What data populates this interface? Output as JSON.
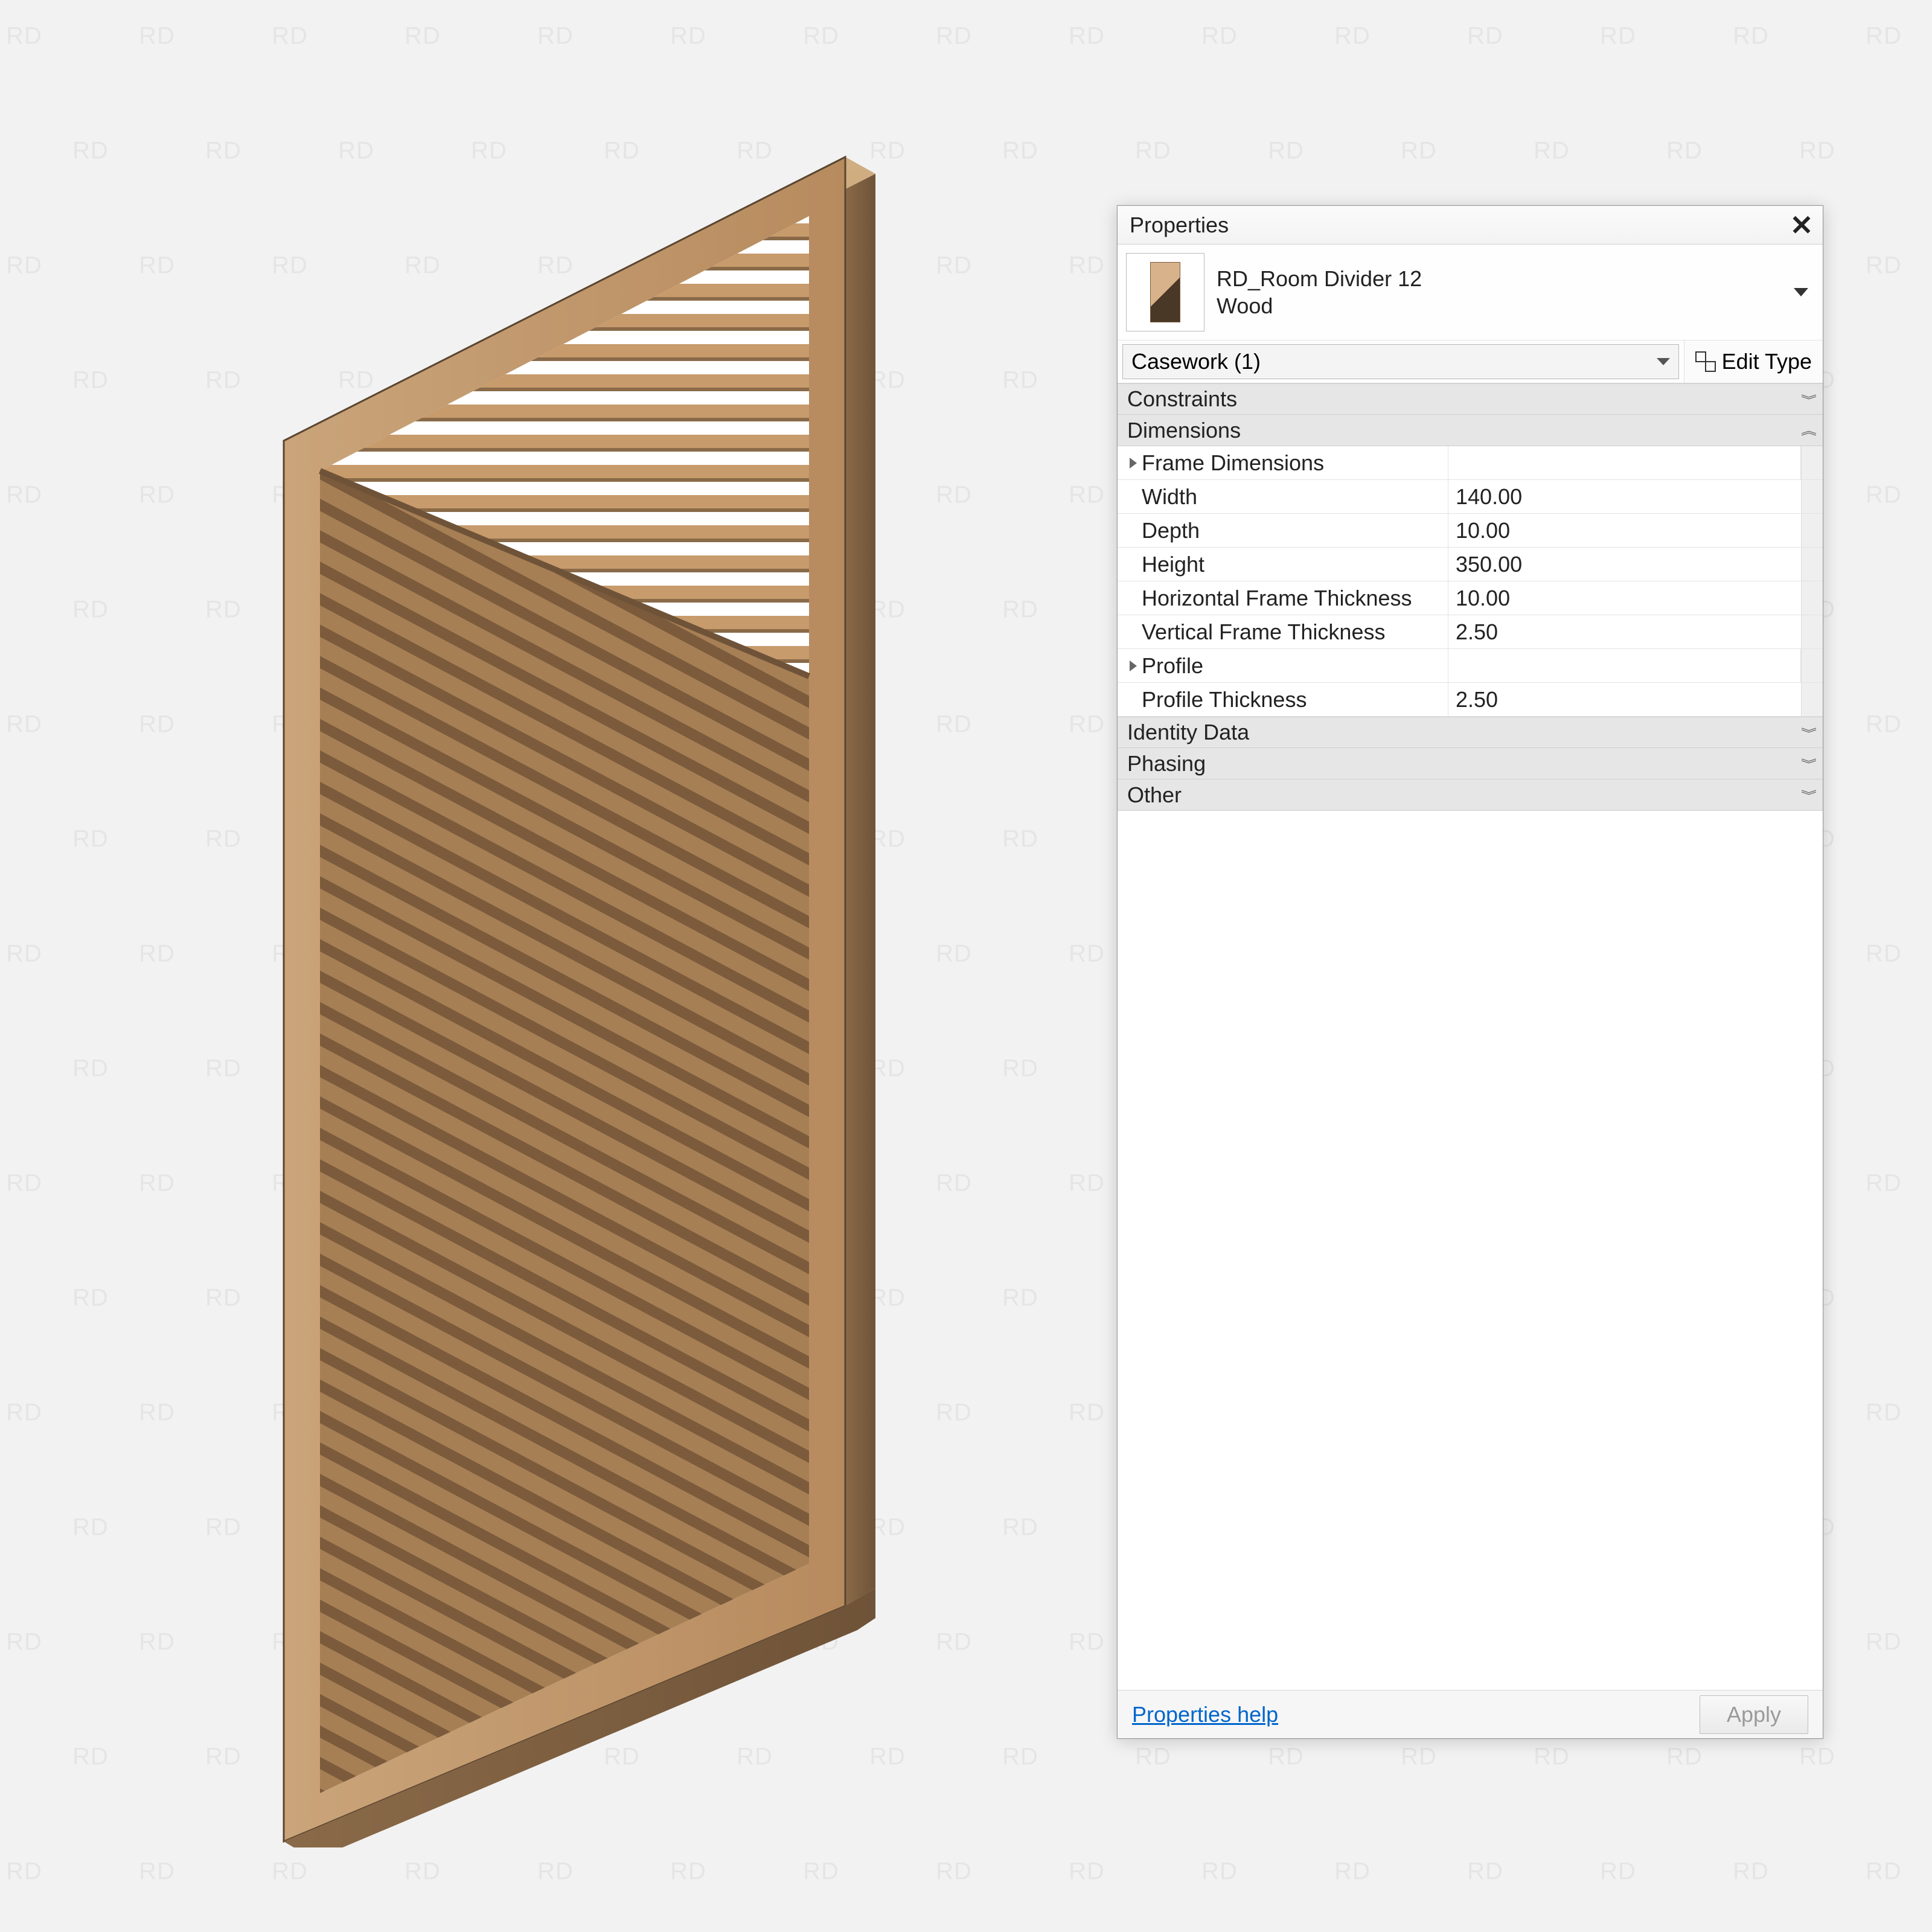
{
  "watermark_text": "RD",
  "panel": {
    "title": "Properties",
    "close_label": "✕",
    "family_name": "RD_Room Divider 12",
    "family_type": "Wood",
    "category": "Casework (1)",
    "edit_type_label": "Edit Type",
    "groups": {
      "constraints": "Constraints",
      "dimensions": "Dimensions",
      "identity": "Identity Data",
      "phasing": "Phasing",
      "other": "Other"
    },
    "dimensions": {
      "frame_dims_label": "Frame Dimensions",
      "width_label": "Width",
      "width_value": "140.00",
      "depth_label": "Depth",
      "depth_value": "10.00",
      "height_label": "Height",
      "height_value": "350.00",
      "hft_label": "Horizontal Frame Thickness",
      "hft_value": "10.00",
      "vft_label": "Vertical Frame Thickness",
      "vft_value": "2.50",
      "profile_label": "Profile",
      "profile_thk_label": "Profile Thickness",
      "profile_thk_value": "2.50"
    },
    "footer": {
      "help": "Properties help",
      "apply": "Apply"
    }
  }
}
